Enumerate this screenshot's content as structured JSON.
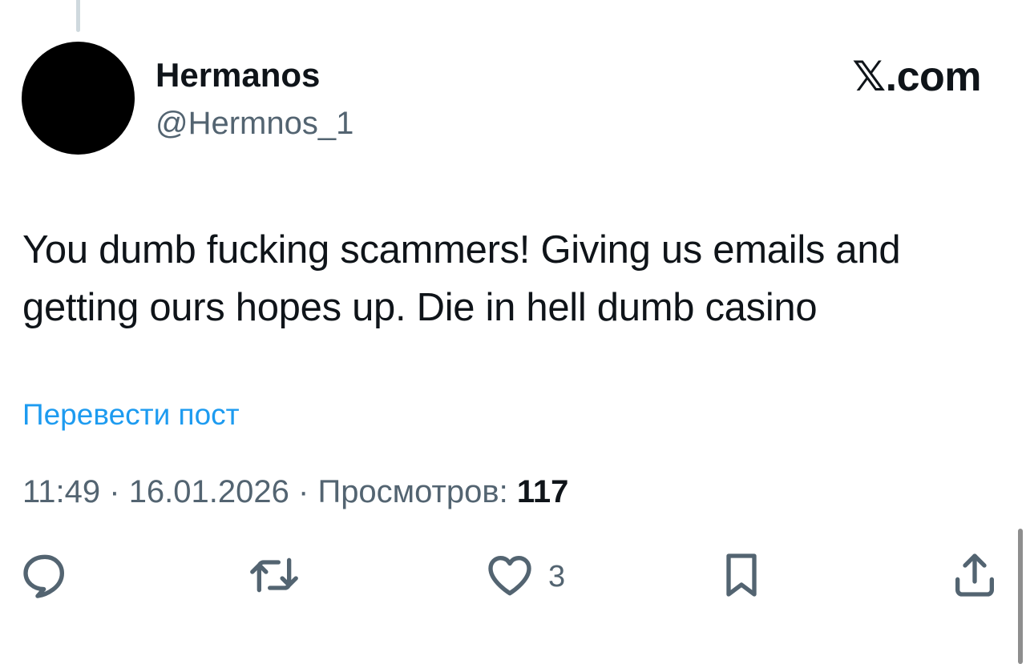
{
  "author": {
    "display_name": "Hermanos",
    "handle": "@Hermnos_1"
  },
  "brand": "𝕏.com",
  "post": {
    "text": "You dumb fucking scammers! Giving us emails and getting ours hopes up. Die in hell dumb casino"
  },
  "translate_label": "Перевести пост",
  "meta": {
    "time": "11:49",
    "separator": " · ",
    "date": "16.01.2026",
    "views_label": "Просмотров:",
    "views_count": "117"
  },
  "actions": {
    "reply_icon": "speech-bubble-icon",
    "repost_icon": "repost-arrows-icon",
    "like_icon": "heart-icon",
    "like_count": "3",
    "bookmark_icon": "bookmark-icon",
    "share_icon": "share-upload-icon"
  },
  "colors": {
    "text": "#0f1419",
    "secondary": "#536471",
    "link": "#1d9bf0"
  }
}
